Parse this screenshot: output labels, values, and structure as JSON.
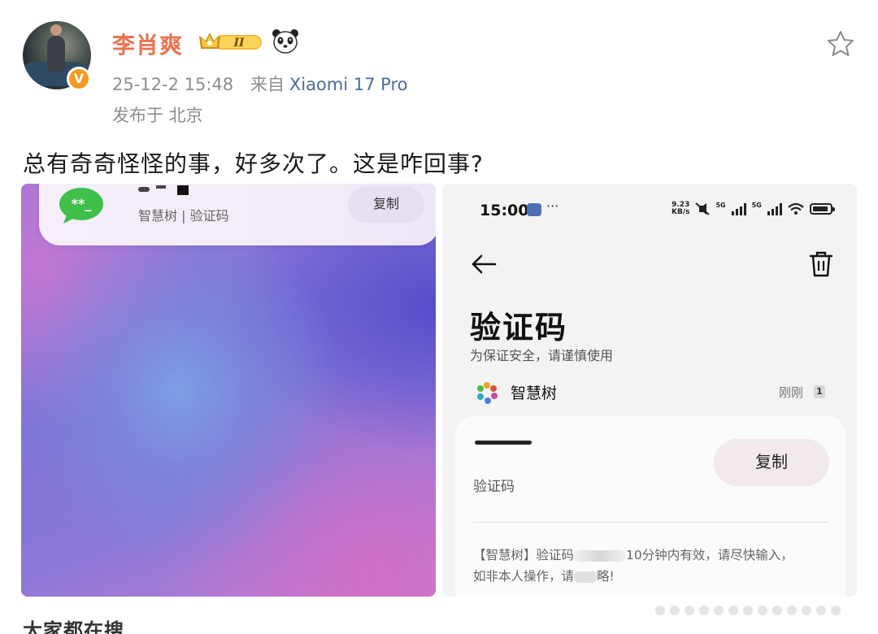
{
  "post": {
    "username": "李肖爽",
    "level_badge": "II",
    "verified_mark": "V",
    "timestamp": "25-12-2 15:48",
    "source_prefix": "来自",
    "source_device": "Xiaomi 17 Pro",
    "location": "发布于 北京",
    "text": "总有奇奇怪怪的事，好多次了。这是咋回事?"
  },
  "left_image": {
    "notification": {
      "subtitle": "智慧树 | 验证码",
      "copy_label": "复制"
    }
  },
  "right_image": {
    "status_bar": {
      "time": "15:00",
      "more": "···",
      "speed_value": "9.23",
      "speed_unit": "KB/s",
      "network": "5G"
    },
    "page_title": "验证码",
    "page_subtitle": "为保证安全，请谨慎使用",
    "sender": "智慧树",
    "time_label": "刚刚",
    "unread_count": "1",
    "card": {
      "code_label": "验证码",
      "copy_label": "复制",
      "body_part1": "【智慧树】验证码",
      "body_part2": "10分钟内有效，请尽快输入，",
      "body_part3": "如非本人操作，请",
      "body_part4": "略!"
    }
  },
  "footer": {
    "search_heading": "大家都在搜"
  },
  "colors": {
    "username": "#eb7350",
    "source_link": "#4e6aa0",
    "verified_badge": "#f39a1f",
    "meta_gray": "#8e8e8e"
  },
  "icons": [
    "star-icon",
    "crown-level-icon",
    "panda-icon",
    "message-app-icon",
    "back-arrow-icon",
    "trash-icon",
    "sender-logo-icon",
    "signal-icon",
    "wifi-icon",
    "battery-icon",
    "mute-icon"
  ]
}
